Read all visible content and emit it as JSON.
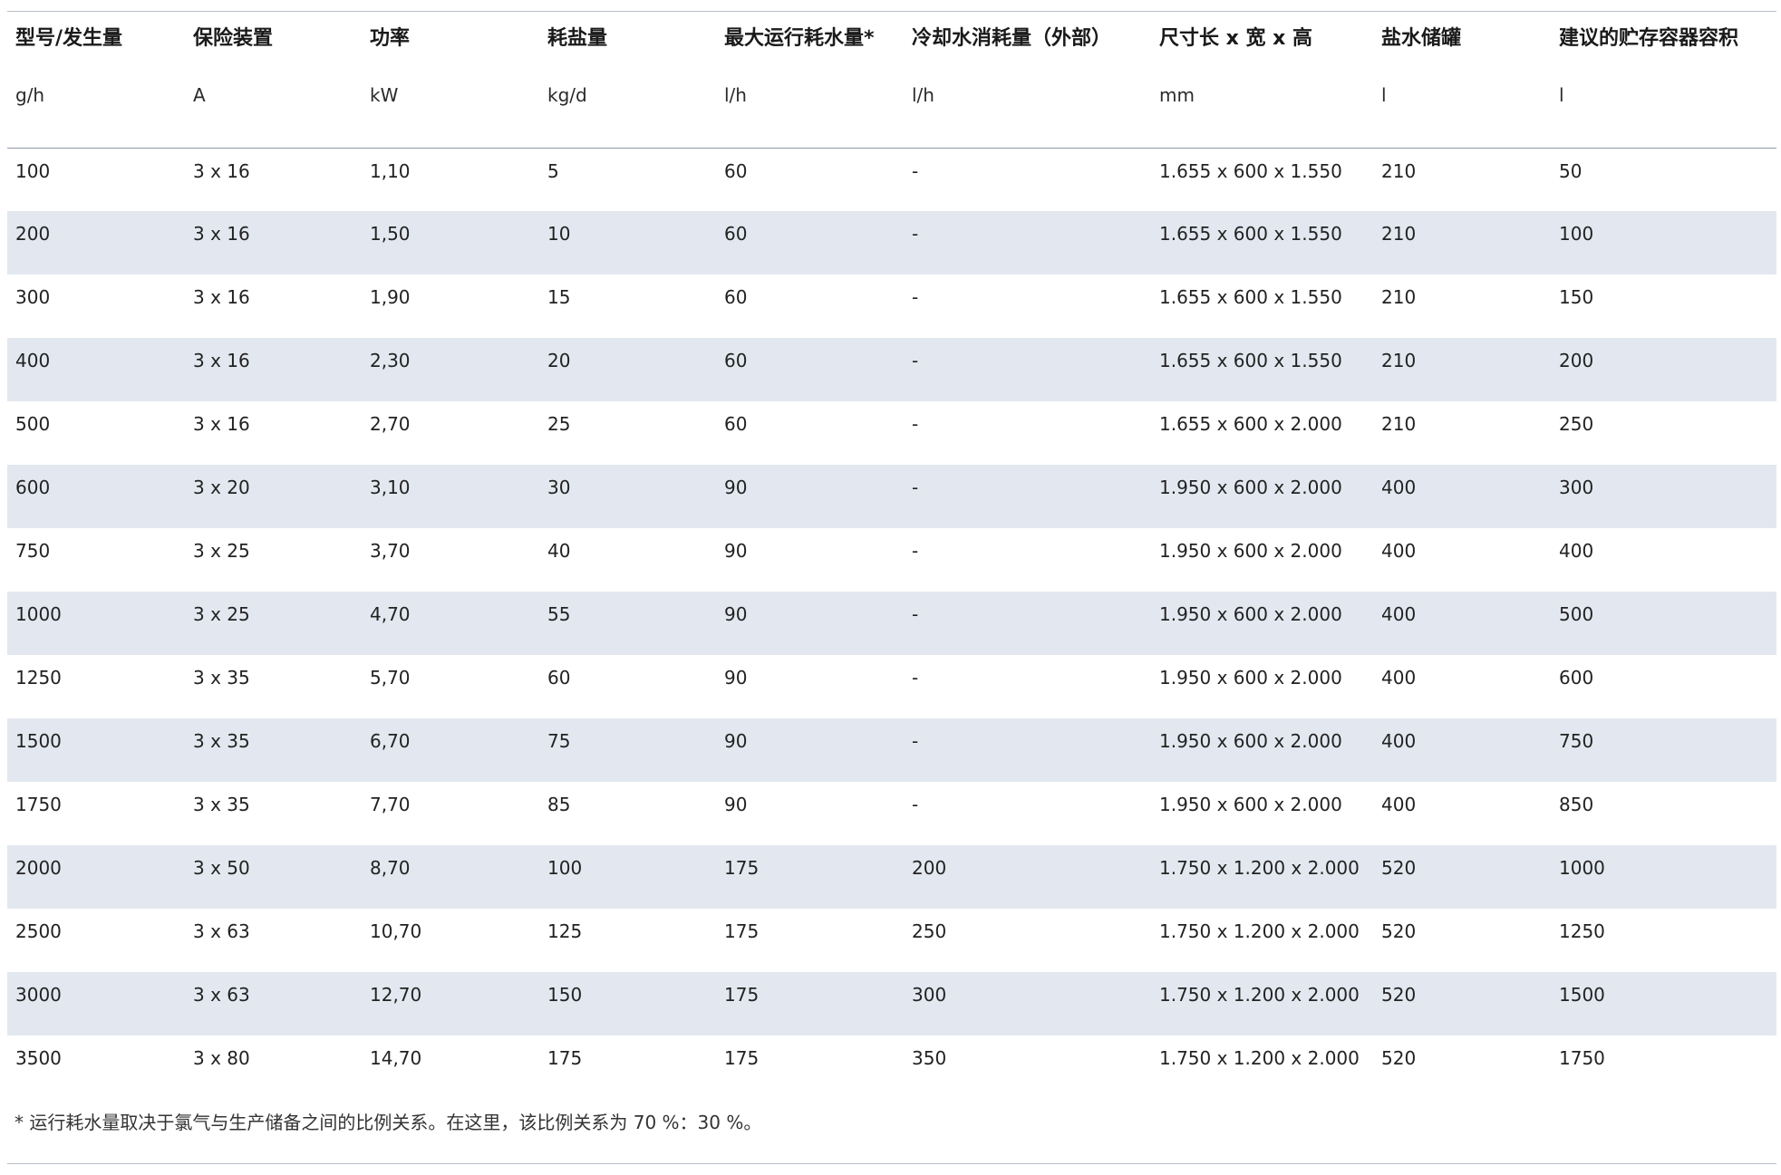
{
  "table": {
    "headers": [
      "型号/发生量",
      "保险装置",
      "功率",
      "耗盐量",
      "最大运行耗水量*",
      "冷却水消耗量（外部）",
      "尺寸长 x 宽 x 高",
      "盐水储罐",
      "建议的贮存容器容积"
    ],
    "units": [
      "g/h",
      "A",
      "kW",
      "kg/d",
      "l/h",
      "l/h",
      "mm",
      "l",
      "l"
    ],
    "rows": [
      [
        "100",
        "3 x 16",
        "1,10",
        "5",
        "60",
        "-",
        "1.655 x 600 x 1.550",
        "210",
        "50"
      ],
      [
        "200",
        "3 x 16",
        "1,50",
        "10",
        "60",
        "-",
        "1.655 x 600 x 1.550",
        "210",
        "100"
      ],
      [
        "300",
        "3 x 16",
        "1,90",
        "15",
        "60",
        "-",
        "1.655 x 600 x 1.550",
        "210",
        "150"
      ],
      [
        "400",
        "3 x 16",
        "2,30",
        "20",
        "60",
        "-",
        "1.655 x 600 x 1.550",
        "210",
        "200"
      ],
      [
        "500",
        "3 x 16",
        "2,70",
        "25",
        "60",
        "-",
        "1.655 x 600 x 2.000",
        "210",
        "250"
      ],
      [
        "600",
        "3 x 20",
        "3,10",
        "30",
        "90",
        "-",
        "1.950 x 600 x 2.000",
        "400",
        "300"
      ],
      [
        "750",
        "3 x 25",
        "3,70",
        "40",
        "90",
        "-",
        "1.950 x 600 x 2.000",
        "400",
        "400"
      ],
      [
        "1000",
        "3 x 25",
        "4,70",
        "55",
        "90",
        "-",
        "1.950 x 600 x 2.000",
        "400",
        "500"
      ],
      [
        "1250",
        "3 x 35",
        "5,70",
        "60",
        "90",
        "-",
        "1.950 x 600 x 2.000",
        "400",
        "600"
      ],
      [
        "1500",
        "3 x 35",
        "6,70",
        "75",
        "90",
        "-",
        "1.950 x 600 x 2.000",
        "400",
        "750"
      ],
      [
        "1750",
        "3 x 35",
        "7,70",
        "85",
        "90",
        "-",
        "1.950 x 600 x 2.000",
        "400",
        "850"
      ],
      [
        "2000",
        "3 x 50",
        "8,70",
        "100",
        "175",
        "200",
        "1.750 x 1.200 x 2.000",
        "520",
        "1000"
      ],
      [
        "2500",
        "3 x 63",
        "10,70",
        "125",
        "175",
        "250",
        "1.750 x 1.200 x 2.000",
        "520",
        "1250"
      ],
      [
        "3000",
        "3 x 63",
        "12,70",
        "150",
        "175",
        "300",
        "1.750 x 1.200 x 2.000",
        "520",
        "1500"
      ],
      [
        "3500",
        "3 x 80",
        "14,70",
        "175",
        "175",
        "350",
        "1.750 x 1.200 x 2.000",
        "520",
        "1750"
      ]
    ]
  },
  "footnote": "* 运行耗水量取决于氯气与生产储备之间的比例关系。在这里，该比例关系为 70 %：30 %。",
  "colors": {
    "stripe": "#e3e8f0",
    "rule": "#b9bec6",
    "header_rule": "#8d98a6"
  }
}
